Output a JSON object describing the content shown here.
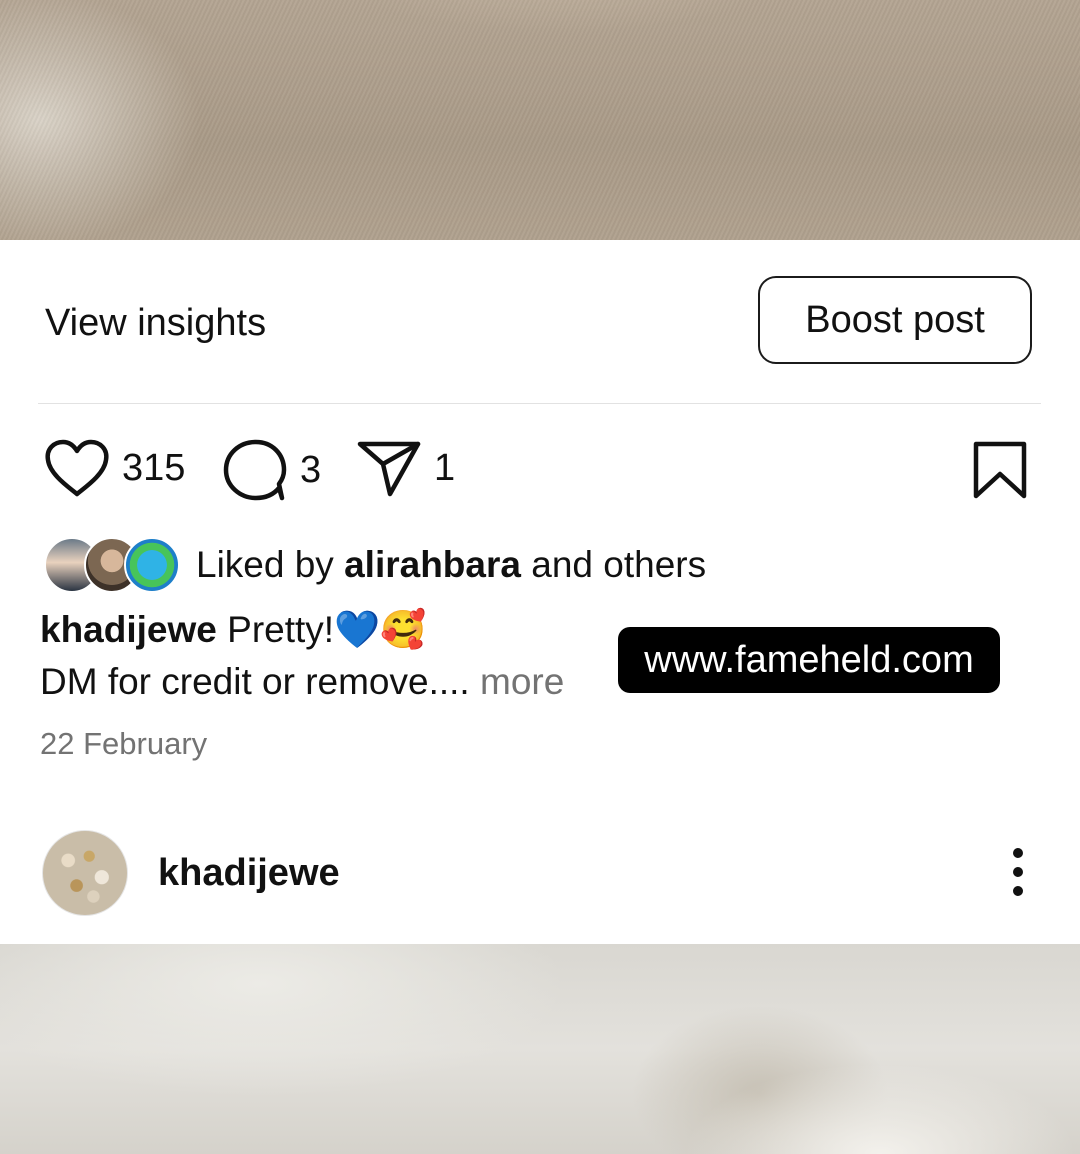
{
  "insights": {
    "view_label": "View insights",
    "boost_label": "Boost post"
  },
  "actions": {
    "likes": "315",
    "comments": "3",
    "shares": "1"
  },
  "liked_by": {
    "prefix": "Liked by ",
    "user": "alirahbara",
    "suffix": " and others"
  },
  "caption": {
    "username": "khadijewe",
    "text": "Pretty!",
    "emojis": "💙🥰",
    "line2": "DM for credit or remove.... ",
    "more": "more"
  },
  "watermark": "www.fameheld.com",
  "date": "22 February",
  "next_post": {
    "username": "khadijewe"
  },
  "icons": [
    "heart-icon",
    "comment-icon",
    "send-icon",
    "bookmark-icon",
    "more-vertical-icon"
  ]
}
